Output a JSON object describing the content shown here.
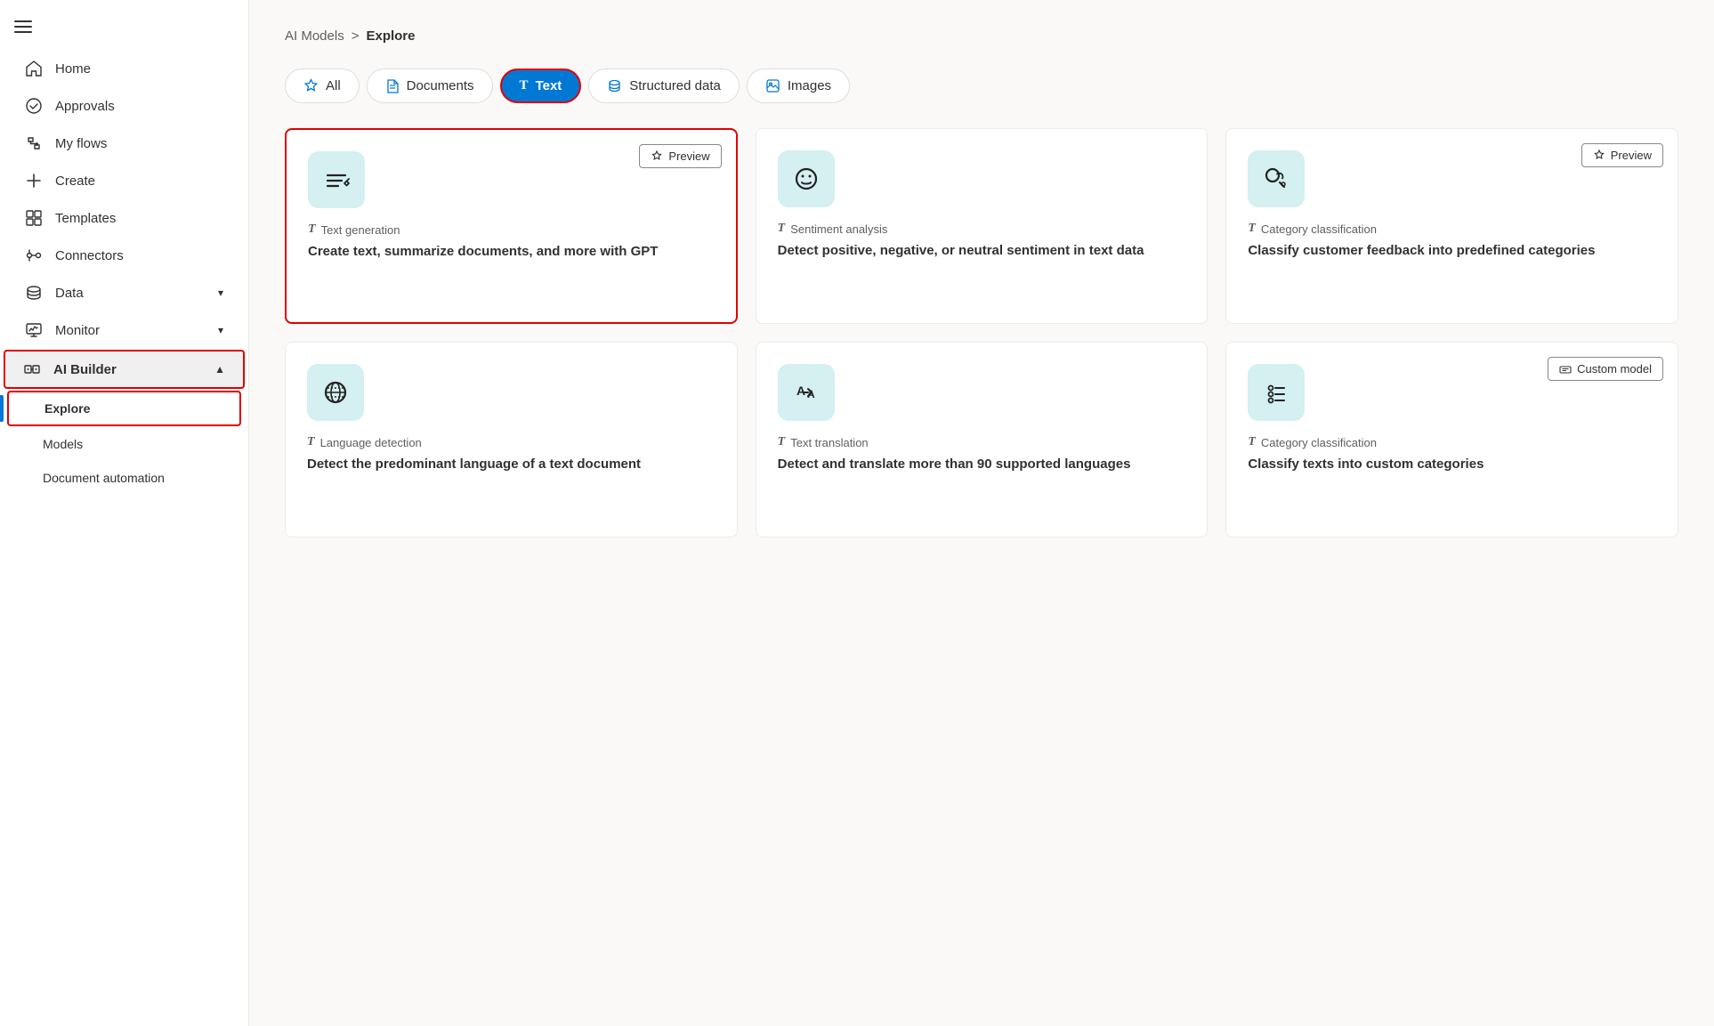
{
  "sidebar": {
    "items": [
      {
        "id": "home",
        "label": "Home",
        "icon": "home"
      },
      {
        "id": "approvals",
        "label": "Approvals",
        "icon": "approvals"
      },
      {
        "id": "my-flows",
        "label": "My flows",
        "icon": "flows"
      },
      {
        "id": "create",
        "label": "Create",
        "icon": "create"
      },
      {
        "id": "templates",
        "label": "Templates",
        "icon": "templates"
      },
      {
        "id": "connectors",
        "label": "Connectors",
        "icon": "connectors"
      },
      {
        "id": "data",
        "label": "Data",
        "icon": "data",
        "chevron": "▾"
      },
      {
        "id": "monitor",
        "label": "Monitor",
        "icon": "monitor",
        "chevron": "▾"
      },
      {
        "id": "ai-builder",
        "label": "AI Builder",
        "icon": "ai-builder",
        "chevron": "▲",
        "expanded": true
      }
    ],
    "sub_items": [
      {
        "id": "explore",
        "label": "Explore",
        "active": true
      },
      {
        "id": "models",
        "label": "Models"
      },
      {
        "id": "document-automation",
        "label": "Document automation"
      }
    ]
  },
  "breadcrumb": {
    "parent": "AI Models",
    "separator": ">",
    "current": "Explore"
  },
  "tabs": [
    {
      "id": "all",
      "label": "All",
      "icon": "star",
      "active": false
    },
    {
      "id": "documents",
      "label": "Documents",
      "icon": "doc",
      "active": false
    },
    {
      "id": "text",
      "label": "Text",
      "icon": "T",
      "active": true
    },
    {
      "id": "structured-data",
      "label": "Structured data",
      "icon": "db",
      "active": false
    },
    {
      "id": "images",
      "label": "Images",
      "icon": "img",
      "active": false
    }
  ],
  "cards": [
    {
      "id": "text-generation",
      "type": "Text generation",
      "badge": "Preview",
      "badge_type": "preview",
      "desc": "Create text, summarize documents, and more with GPT",
      "selected": true,
      "icon": "text-gen"
    },
    {
      "id": "sentiment-analysis",
      "type": "Sentiment analysis",
      "badge": null,
      "badge_type": null,
      "desc": "Detect positive, negative, or neutral sentiment in text data",
      "selected": false,
      "icon": "sentiment"
    },
    {
      "id": "category-classification-1",
      "type": "Category classification",
      "badge": "Preview",
      "badge_type": "preview",
      "desc": "Classify customer feedback into predefined categories",
      "selected": false,
      "icon": "category"
    },
    {
      "id": "language-detection",
      "type": "Language detection",
      "badge": null,
      "badge_type": null,
      "desc": "Detect the predominant language of a text document",
      "selected": false,
      "icon": "language"
    },
    {
      "id": "text-translation",
      "type": "Text translation",
      "badge": null,
      "badge_type": null,
      "desc": "Detect and translate more than 90 supported languages",
      "selected": false,
      "icon": "translation"
    },
    {
      "id": "category-classification-2",
      "type": "Category classification",
      "badge": "Custom model",
      "badge_type": "custom",
      "desc": "Classify texts into custom categories",
      "selected": false,
      "icon": "custom-category"
    }
  ],
  "labels": {
    "preview": "Preview",
    "custom_model": "Custom model"
  }
}
